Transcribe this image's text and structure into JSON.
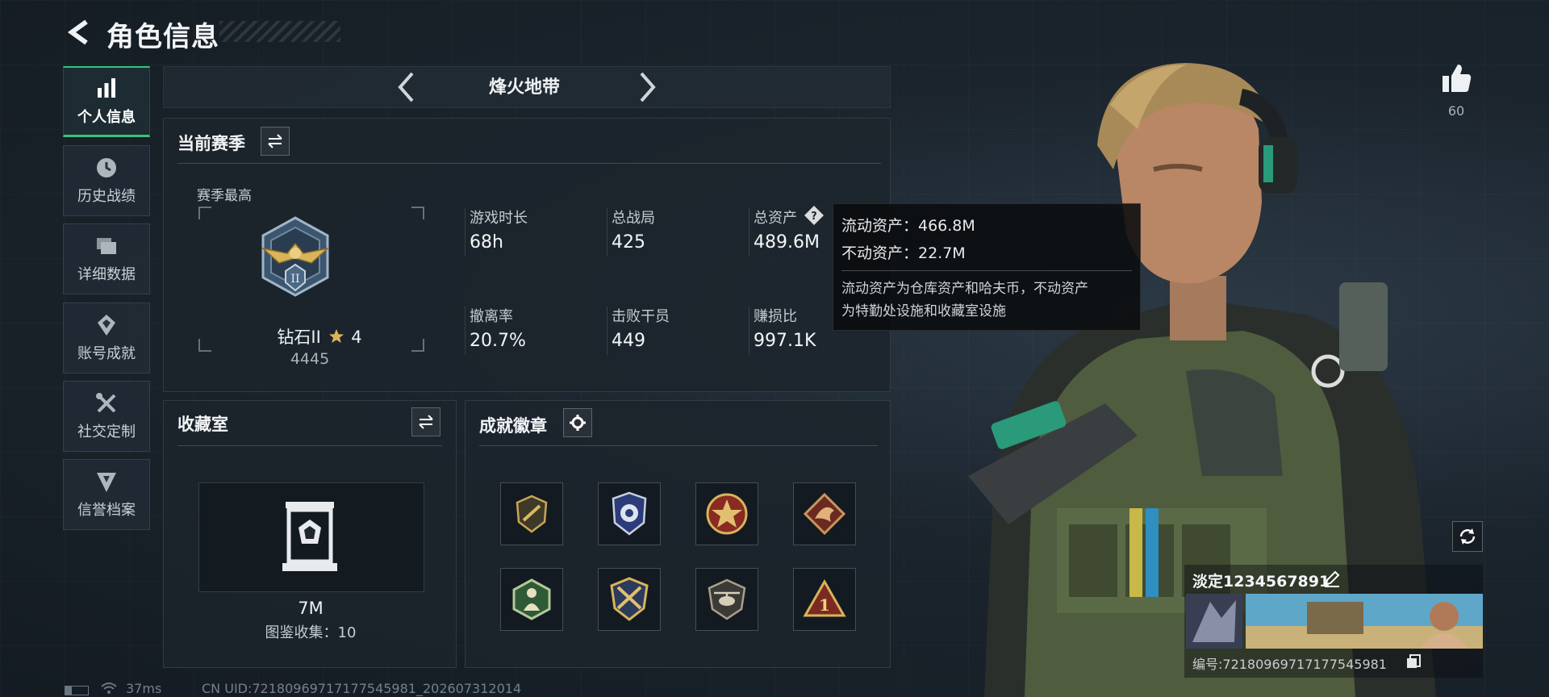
{
  "header": {
    "title": "角色信息"
  },
  "sidebar": {
    "items": [
      {
        "label": "个人信息",
        "icon": "bar-chart-icon",
        "active": true
      },
      {
        "label": "历史战绩",
        "icon": "history-clock-icon",
        "active": false
      },
      {
        "label": "详细数据",
        "icon": "folders-icon",
        "active": false
      },
      {
        "label": "账号成就",
        "icon": "achievement-icon",
        "active": false
      },
      {
        "label": "社交定制",
        "icon": "tools-icon",
        "active": false
      },
      {
        "label": "信誉档案",
        "icon": "reputation-icon",
        "active": false
      }
    ]
  },
  "mode": {
    "label": "烽火地带"
  },
  "season": {
    "title": "当前赛季",
    "best_label": "赛季最高",
    "rank_name": "钻石II",
    "rank_stars": "4",
    "rank_score": "4445",
    "stats": [
      {
        "label": "游戏时长",
        "value": "68h"
      },
      {
        "label": "总战局",
        "value": "425"
      },
      {
        "label": "总资产",
        "value": "489.6M"
      },
      {
        "label": "撤离率",
        "value": "20.7%"
      },
      {
        "label": "击败干员",
        "value": "449"
      },
      {
        "label": "赚损比",
        "value": "997.1K"
      }
    ]
  },
  "tooltip": {
    "liquid": "流动资产：466.8M",
    "fixed": "不动资产：22.7M",
    "desc_line1": "流动资产为仓库资产和哈夫币，不动资产",
    "desc_line2": "为特勤处设施和收藏室设施"
  },
  "collection": {
    "title": "收藏室",
    "value": "7M",
    "catalog": "图鉴收集：10"
  },
  "achievements": {
    "title": "成就徽章",
    "badges": [
      "rifle-badge-icon",
      "shield-badge-icon",
      "star-badge-icon",
      "dragon-badge-icon",
      "figure-badge-icon",
      "crossed-guns-badge-icon",
      "helicopter-badge-icon",
      "number-one-badge-icon"
    ]
  },
  "profile": {
    "likes": "60",
    "name": "淡定1234567891",
    "id_text": "编号:72180969717177545981"
  },
  "footer": {
    "ping": "37ms",
    "uid": "CN UID:72180969717177545981_202607312014"
  },
  "colors": {
    "accent": "#39c27a",
    "gold": "#d8b45a",
    "panel": "#1c242c"
  }
}
